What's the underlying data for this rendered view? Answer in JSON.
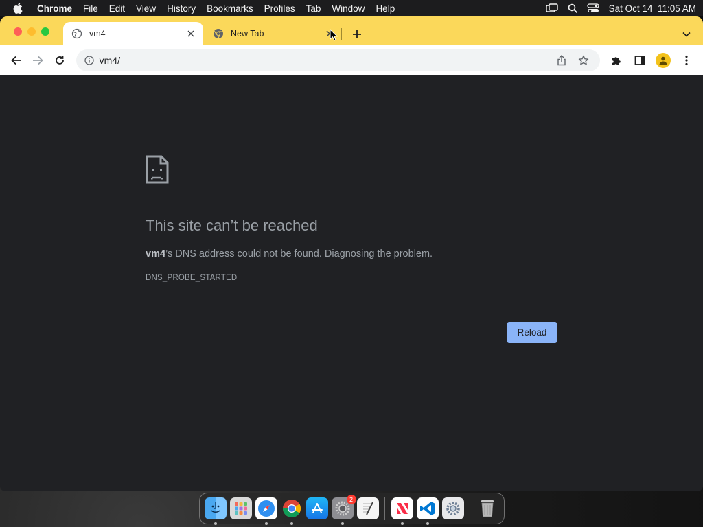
{
  "menubar": {
    "app_name": "Chrome",
    "items": [
      "File",
      "Edit",
      "View",
      "History",
      "Bookmarks",
      "Profiles",
      "Tab",
      "Window",
      "Help"
    ],
    "clock": "Sat Oct 14  11:05 AM"
  },
  "tabs": [
    {
      "title": "vm4",
      "active": true
    },
    {
      "title": "New Tab",
      "active": false
    }
  ],
  "omnibox": {
    "url": "vm4/"
  },
  "error": {
    "title": "This site can’t be reached",
    "host": "vm4",
    "message": "’s DNS address could not be found. Diagnosing the problem.",
    "code": "DNS_PROBE_STARTED",
    "reload_label": "Reload"
  },
  "dock": {
    "settings_badge": "2",
    "apps": [
      "finder",
      "launchpad",
      "safari",
      "chrome",
      "app-store",
      "system-settings",
      "textedit",
      "news",
      "vscode",
      "settings-alt",
      "trash"
    ]
  },
  "colors": {
    "tabstrip": "#fbd85a",
    "page_bg": "#202124",
    "reload_button": "#8ab4f8",
    "error_text": "#9aa0a6"
  }
}
